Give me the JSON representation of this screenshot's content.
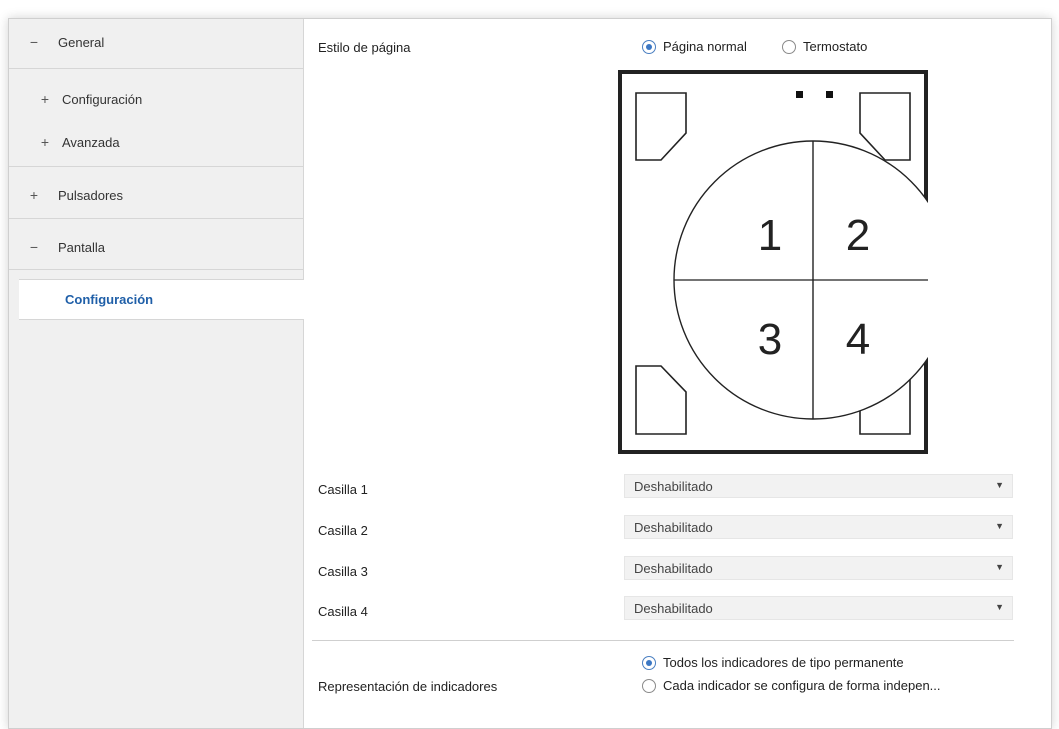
{
  "sidebar": {
    "items": [
      {
        "symbol": "−",
        "label": "General"
      },
      {
        "symbol": "+",
        "label": "Configuración"
      },
      {
        "symbol": "+",
        "label": "Avanzada"
      },
      {
        "symbol": "+",
        "label": "Pulsadores"
      },
      {
        "symbol": "−",
        "label": "Pantalla"
      }
    ],
    "selected": "Configuración"
  },
  "page_style": {
    "label": "Estilo de página",
    "options": [
      "Página normal",
      "Termostato"
    ],
    "selected": "Página normal"
  },
  "diagram": {
    "cells": [
      "1",
      "2",
      "3",
      "4"
    ]
  },
  "boxes": [
    {
      "label": "Casilla 1",
      "value": "Deshabilitado"
    },
    {
      "label": "Casilla 2",
      "value": "Deshabilitado"
    },
    {
      "label": "Casilla 3",
      "value": "Deshabilitado"
    },
    {
      "label": "Casilla 4",
      "value": "Deshabilitado"
    }
  ],
  "indicators": {
    "label": "Representación de indicadores",
    "options": [
      "Todos los indicadores de tipo permanente",
      "Cada indicador se configura de forma indepen..."
    ],
    "selected": "Todos los indicadores de tipo permanente"
  },
  "colors": {
    "accent": "#1f5fa8",
    "radio": "#3b77c4"
  }
}
